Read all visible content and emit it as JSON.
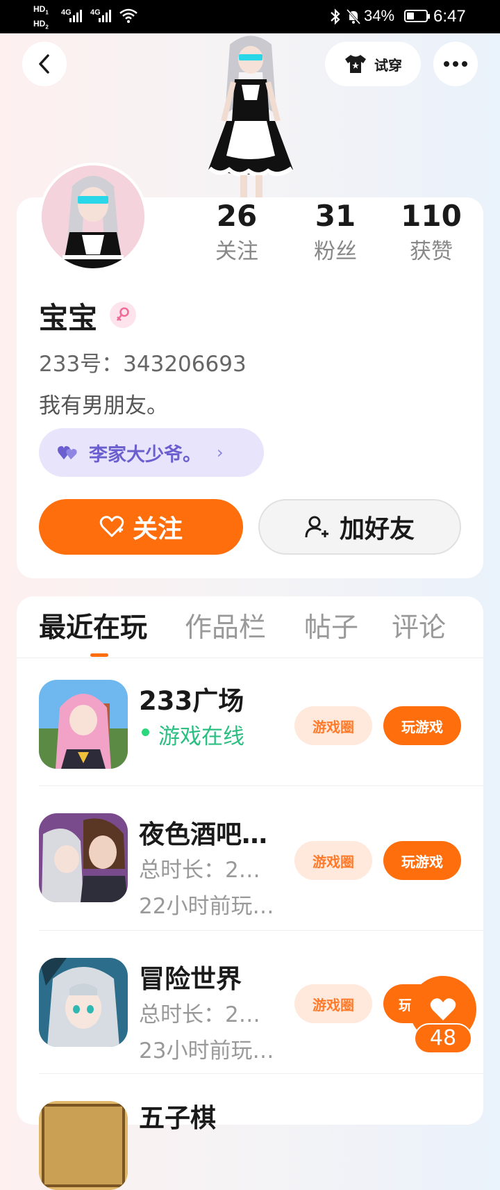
{
  "status_bar": {
    "hd1": "HD",
    "hd1_sub": "1",
    "hd2": "HD",
    "hd2_sub": "2",
    "sig1": "4G",
    "sig2": "4G",
    "battery": "34%",
    "time": "6:47"
  },
  "header": {
    "back_icon": "chevron-left-icon",
    "tryon_label": "试穿",
    "more_icon": "more-dots-icon"
  },
  "profile": {
    "stats": [
      {
        "value": "26",
        "label": "关注"
      },
      {
        "value": "31",
        "label": "粉丝"
      },
      {
        "value": "110",
        "label": "获赞"
      }
    ],
    "name": "宝宝",
    "gender_icon": "female-icon",
    "uid": "233号：343206693",
    "bio": "我有男朋友。",
    "couple_label": "李家大少爷。",
    "follow_label": "关注",
    "add_friend_label": "加好友"
  },
  "tabs": [
    {
      "label": "最近在玩",
      "active": true
    },
    {
      "label": "作品栏",
      "active": false
    },
    {
      "label": "帖子",
      "active": false
    },
    {
      "label": "评论",
      "active": false
    }
  ],
  "games": [
    {
      "title": "233广场",
      "sub1": "游戏在线",
      "sub2": "",
      "circle_label": "游戏圈",
      "play_label": "玩游戏"
    },
    {
      "title": "夜色酒吧…",
      "sub1": "总时长：2…",
      "sub2": "22小时前玩…",
      "circle_label": "游戏圈",
      "play_label": "玩游戏"
    },
    {
      "title": "冒险世界",
      "sub1": "总时长：2…",
      "sub2": "23小时前玩…",
      "circle_label": "游戏圈",
      "play_label": "玩"
    },
    {
      "title": "五子棋",
      "sub1": "",
      "sub2": "",
      "circle_label": "",
      "play_label": ""
    }
  ],
  "like_fab": {
    "count": "48"
  },
  "colors": {
    "accent": "#ff6e0d",
    "online": "#2cbf82",
    "couple": "#6b5fd0"
  }
}
